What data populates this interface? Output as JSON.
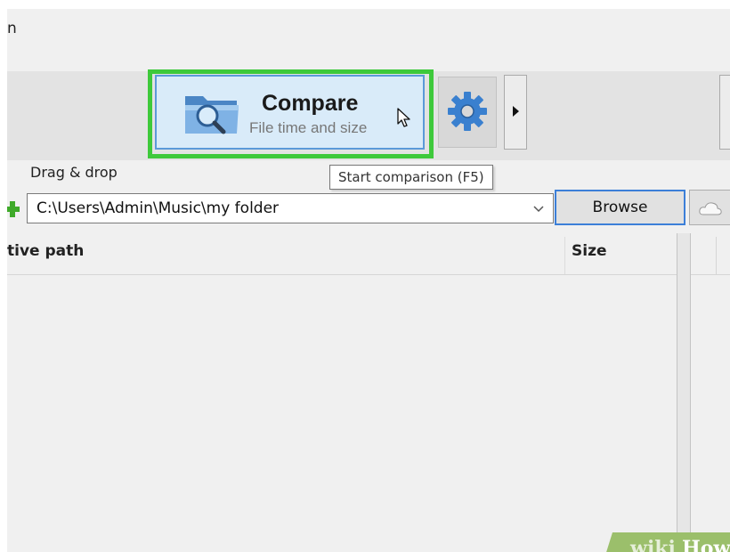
{
  "window": {
    "title_fragment": "n"
  },
  "toolbar": {
    "compare_label": "Compare",
    "compare_sub": "File time and size",
    "highlight_color": "#3ec93b"
  },
  "tooltip": {
    "text": "Start comparison (F5)"
  },
  "left_panel": {
    "drag_drop": "Drag & drop",
    "path_value": "C:\\Users\\Admin\\Music\\my folder",
    "browse_label": "Browse"
  },
  "columns": {
    "path": "tive path",
    "size": "Size"
  },
  "watermark": {
    "brand": "wikiHow"
  },
  "icons": [
    "folder-search-icon",
    "gear-icon",
    "chevron-right-icon",
    "plus-icon",
    "chevron-down-icon",
    "cloud-icon",
    "cursor-icon"
  ]
}
